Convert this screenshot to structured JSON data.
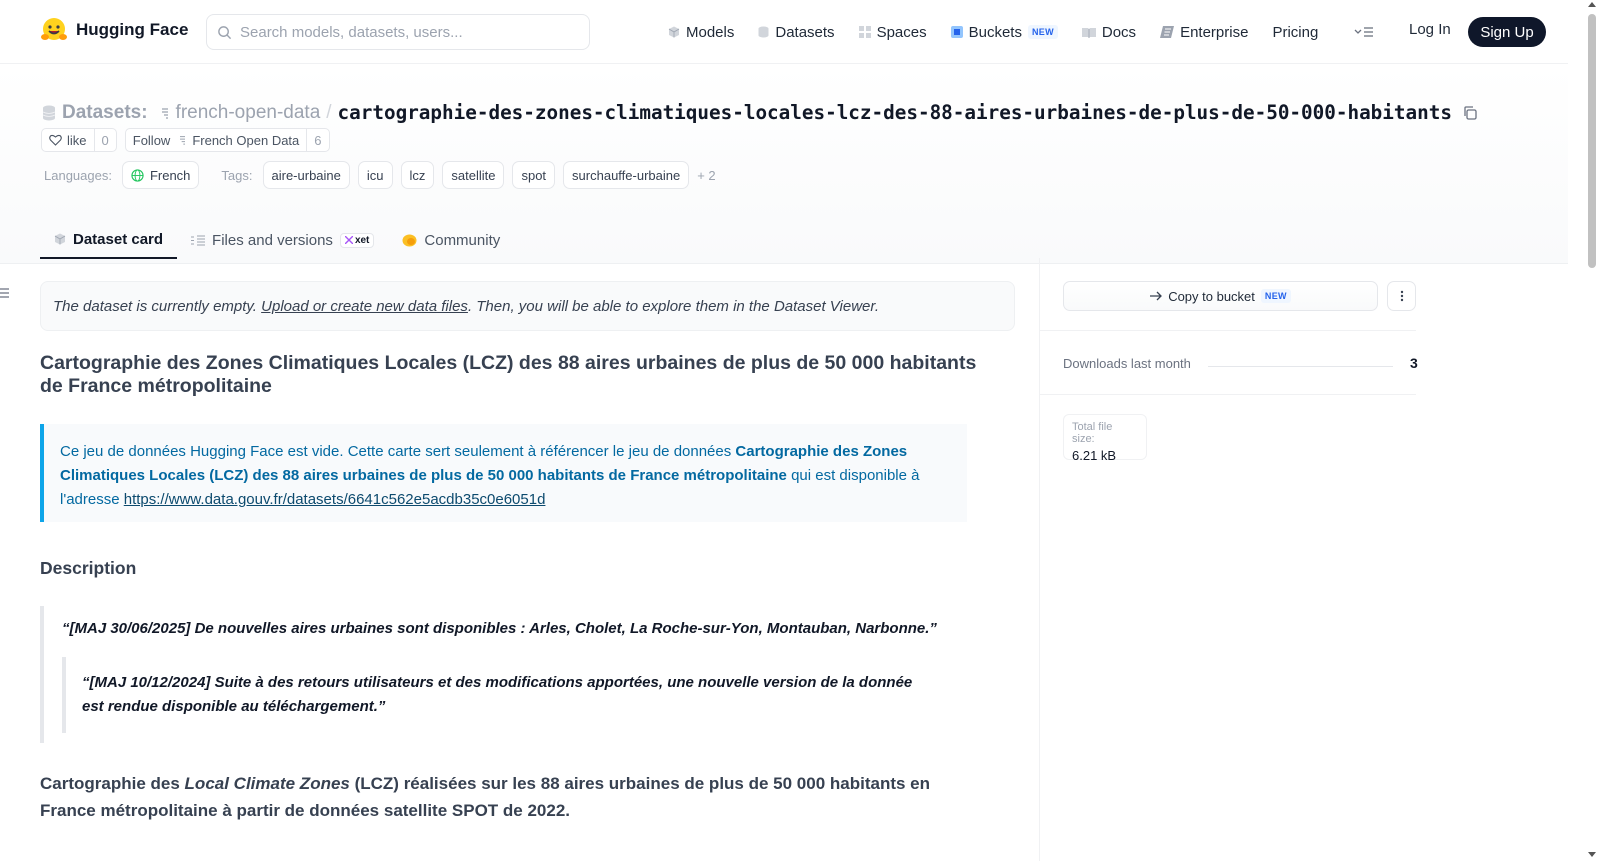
{
  "nav": {
    "brand": "Hugging Face",
    "search_placeholder": "Search models, datasets, users...",
    "items": [
      {
        "label": "Models",
        "icon": "cube-icon"
      },
      {
        "label": "Datasets",
        "icon": "database-icon"
      },
      {
        "label": "Spaces",
        "icon": "grid-icon"
      },
      {
        "label": "Buckets",
        "icon": "bucket-icon",
        "badge": "NEW"
      },
      {
        "label": "Docs",
        "icon": "book-icon"
      },
      {
        "label": "Enterprise",
        "icon": "enterprise-icon"
      },
      {
        "label": "Pricing"
      }
    ],
    "login": "Log In",
    "signup": "Sign Up"
  },
  "header": {
    "prefix": "Datasets:",
    "org": "french-open-data",
    "separator": "/",
    "repo": "cartographie-des-zones-climatiques-locales-lcz-des-88-aires-urbaines-de-plus-de-50-000-habitants",
    "like_label": "like",
    "like_count": "0",
    "follow_label": "Follow",
    "follow_org": "French Open Data",
    "follow_count": "6",
    "languages_label": "Languages:",
    "language": "French",
    "tags_label": "Tags:",
    "tags": [
      "aire-urbaine",
      "icu",
      "lcz",
      "satellite",
      "spot",
      "surchauffe-urbaine"
    ],
    "tags_more": "+ 2"
  },
  "tabs": {
    "dataset_card": "Dataset card",
    "files": "Files and versions",
    "xet": "xet",
    "community": "Community"
  },
  "main": {
    "empty_notice": {
      "pre": "The dataset is currently empty. ",
      "link": "Upload or create new data files",
      "post": ". Then, you will be able to explore them in the Dataset Viewer."
    },
    "title": "Cartographie des Zones Climatiques Locales (LCZ) des 88 aires urbaines de plus de 50 000 habitants de France métropolitaine",
    "info": {
      "pre": "Ce jeu de données Hugging Face est vide. Cette carte sert seulement à référencer le jeu de données ",
      "bold": "Cartographie des Zones Climatiques Locales (LCZ) des 88 aires urbaines de plus de 50 000 habitants de France métropolitaine",
      "post": " qui est disponible à l'adresse ",
      "link": "https://www.data.gouv.fr/datasets/6641c562e5acdb35c0e6051d"
    },
    "description_heading": "Description",
    "quote1": "“[MAJ 30/06/2025] De nouvelles aires urbaines sont disponibles : Arles, Cholet, La Roche-sur-Yon, Montauban, Narbonne.”",
    "quote2": "“[MAJ 10/12/2024] Suite à des retours utilisateurs et des modifications apportées, une nouvelle version de la donnée est rendue disponible au téléchargement.”",
    "body": {
      "pre": "Cartographie des ",
      "italic": "Local Climate Zones",
      "post": " (LCZ) réalisées sur les 88 aires urbaines de plus de 50 000 habitants en France métropolitaine à partir de données satellite SPOT de 2022."
    }
  },
  "sidebar": {
    "copy_bucket": "Copy to bucket",
    "copy_bucket_badge": "NEW",
    "downloads_label": "Downloads last month",
    "downloads_value": "3",
    "size_label": "Total file size:",
    "size_value": "6.21 kB"
  },
  "colors": {
    "accent_blue": "#0ea5e9",
    "info_text": "#0369a1",
    "signup_bg": "#0f172a"
  }
}
